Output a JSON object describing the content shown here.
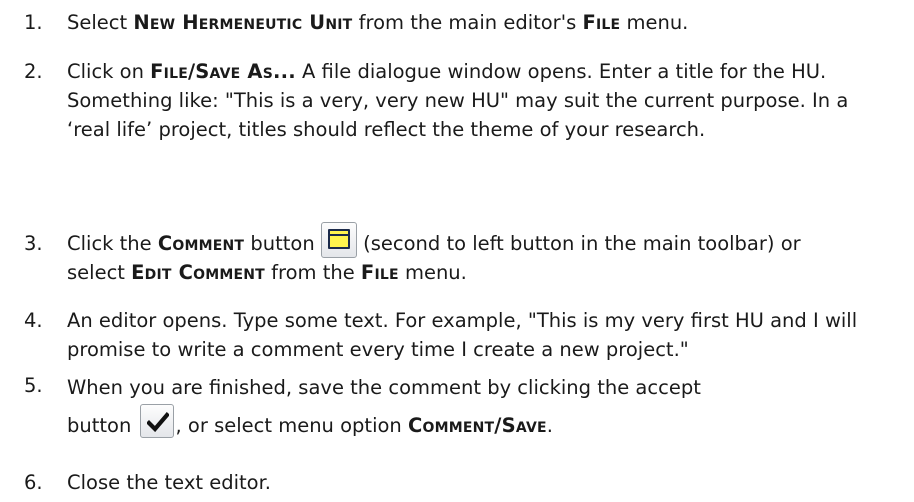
{
  "steps": [
    {
      "number": "1.",
      "segments": [
        {
          "text": "Select "
        },
        {
          "text": "New Hermeneutic Unit",
          "sc": true
        },
        {
          "text": " from the main editor's "
        },
        {
          "text": "File",
          "sc": true
        },
        {
          "text": " menu."
        }
      ]
    },
    {
      "number": "2.",
      "segments": [
        {
          "text": "Click on "
        },
        {
          "text": "File/Save As...",
          "sc": true
        },
        {
          "text": " A file dialogue window opens. Enter a title for the HU. Something like: \"This is a very, very new HU\" may suit the current purpose. In a ‘real life’ project, titles should reflect the theme of your research."
        }
      ]
    },
    {
      "number": "3.",
      "segments": [
        {
          "text": "Click the "
        },
        {
          "text": "Comment",
          "sc": true
        },
        {
          "text": " button "
        },
        {
          "icon": "comment-window-icon"
        },
        {
          "text": " (second to left button in the main toolbar) or select "
        },
        {
          "text": "Edit Comment",
          "sc": true
        },
        {
          "text": " from the "
        },
        {
          "text": "File",
          "sc": true
        },
        {
          "text": " menu."
        }
      ]
    },
    {
      "number": "4.",
      "segments": [
        {
          "text": "An editor opens. Type some text. For example, \"This is my very first HU and I will promise to write a comment every time I create a new project.\""
        }
      ]
    },
    {
      "number": "5.",
      "segments": [
        {
          "text": "When you are finished, save the comment by clicking the accept button "
        },
        {
          "icon": "checkmark-icon"
        },
        {
          "text": ", or select menu option "
        },
        {
          "text": "Comment/Save",
          "sc": true
        },
        {
          "text": "."
        }
      ]
    },
    {
      "number": "6.",
      "segments": [
        {
          "text": "Close the text editor."
        }
      ]
    }
  ],
  "colors": {
    "text": "#1a1a1a",
    "comment_icon_fill": "#fff44d",
    "icon_outline": "#1b2a4a"
  }
}
